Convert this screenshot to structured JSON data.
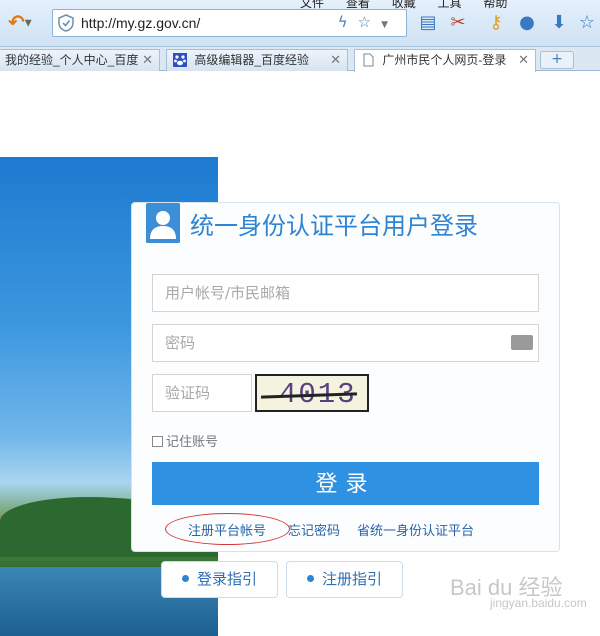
{
  "browser": {
    "menu": [
      "文件",
      "查看",
      "收藏",
      "工具",
      "帮助"
    ],
    "address_url": "http://my.gz.gov.cn/",
    "tabs": [
      {
        "label": "我的经验_个人中心_百度"
      },
      {
        "label": "高级编辑器_百度经验"
      },
      {
        "label": "广州市民个人网页-登录"
      }
    ],
    "new_tab_label": "+"
  },
  "login": {
    "title": "统一身份认证平台用户登录",
    "username_placeholder": "用户帐号/市民邮箱",
    "password_placeholder": "密码",
    "captcha_placeholder": "验证码",
    "captcha_text": "4013",
    "remember_label": "记住账号",
    "submit_label": "登录",
    "links": {
      "register": "注册平台帐号",
      "forgot": "忘记密码",
      "province": "省统一身份认证平台"
    },
    "guides": {
      "login_guide": "登录指引",
      "register_guide": "注册指引"
    }
  },
  "watermark": {
    "brand": "Bai du 经验",
    "sub": "jingyan.baidu.com"
  },
  "colors": {
    "accent": "#2f91e2",
    "title": "#2f84d2",
    "link": "#2a63a8",
    "annotation": "#d23a3a"
  }
}
